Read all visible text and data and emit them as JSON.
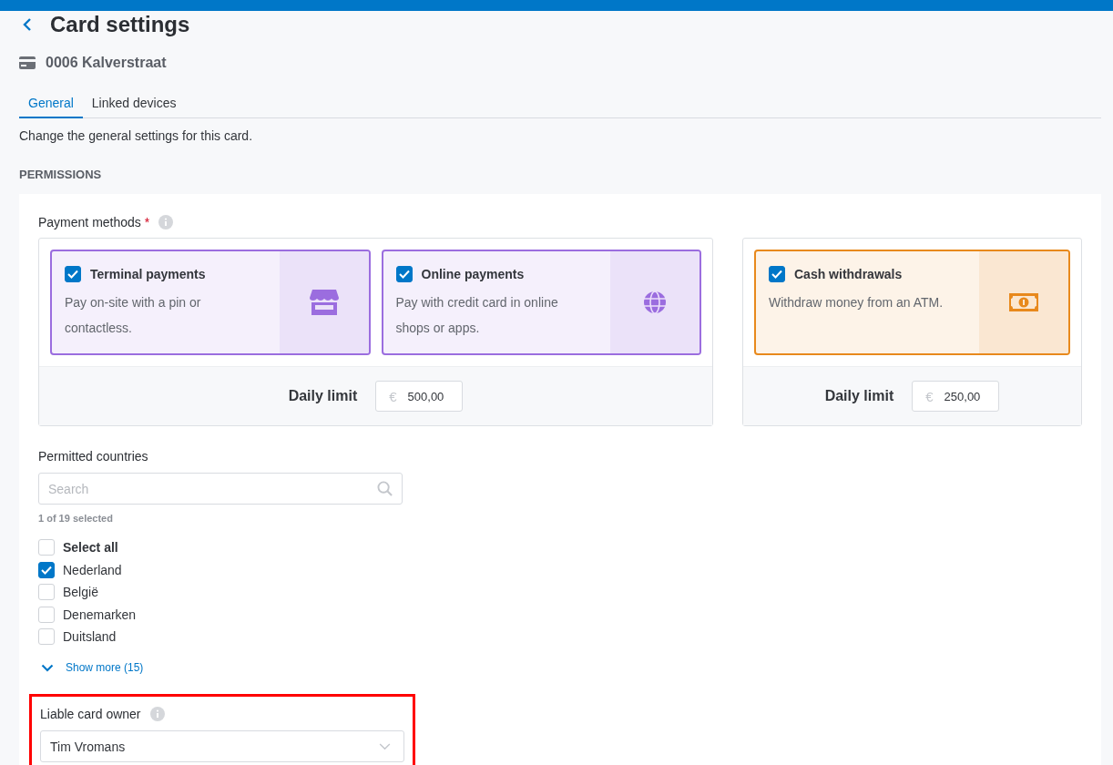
{
  "header": {
    "title": "Card settings",
    "card_name": "0006 Kalverstraat"
  },
  "tabs": [
    {
      "label": "General",
      "selected": true
    },
    {
      "label": "Linked devices",
      "selected": false
    }
  ],
  "description": "Change the general settings for this card.",
  "section_heading": "PERMISSIONS",
  "payment_methods": {
    "label": "Payment methods",
    "required_mark": "*",
    "groups": [
      {
        "methods": [
          {
            "title": "Terminal payments",
            "text": "Pay on-site with a pin or contactless.",
            "checked": true,
            "kind": "store",
            "color": "#9b6ddf"
          },
          {
            "title": "Online payments",
            "text": "Pay with credit card in online shops or apps.",
            "checked": true,
            "kind": "globe",
            "color": "#9b6ddf"
          }
        ],
        "limit_label": "Daily limit",
        "currency": "€",
        "limit_value": "500,00"
      },
      {
        "methods": [
          {
            "title": "Cash withdrawals",
            "text": "Withdraw money from an ATM.",
            "checked": true,
            "kind": "cash",
            "color": "#e8891c"
          }
        ],
        "limit_label": "Daily limit",
        "currency": "€",
        "limit_value": "250,00"
      }
    ]
  },
  "countries": {
    "label": "Permitted countries",
    "search": {
      "placeholder": "Search"
    },
    "count": "1 of 19 selected",
    "items": [
      {
        "label": "Select all",
        "checked": false,
        "kind": "all"
      },
      {
        "label": "Nederland",
        "checked": true,
        "kind": "country"
      },
      {
        "label": "België",
        "checked": false,
        "kind": "country"
      },
      {
        "label": "Denemarken",
        "checked": false,
        "kind": "country"
      },
      {
        "label": "Duitsland",
        "checked": false,
        "kind": "country"
      }
    ],
    "show_more": "Show more (15)"
  },
  "liable_owner": {
    "label": "Liable card owner",
    "value": "Tim Vromans",
    "highlighted": true
  }
}
